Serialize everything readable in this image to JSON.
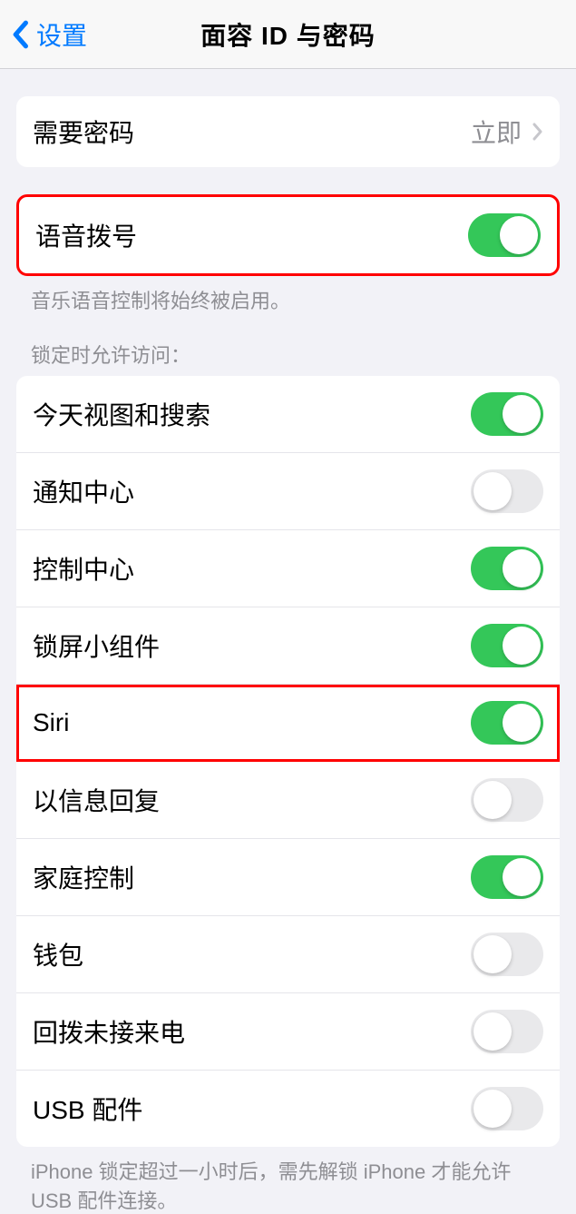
{
  "nav": {
    "back_label": "设置",
    "title": "面容 ID 与密码"
  },
  "passcode_section": {
    "require_label": "需要密码",
    "require_value": "立即"
  },
  "voice_dial": {
    "label": "语音拨号",
    "enabled": true,
    "footer": "音乐语音控制将始终被启用。"
  },
  "locked_access": {
    "header": "锁定时允许访问：",
    "items": [
      {
        "label": "今天视图和搜索",
        "enabled": true,
        "highlighted": false
      },
      {
        "label": "通知中心",
        "enabled": false,
        "highlighted": false
      },
      {
        "label": "控制中心",
        "enabled": true,
        "highlighted": false
      },
      {
        "label": "锁屏小组件",
        "enabled": true,
        "highlighted": false
      },
      {
        "label": "Siri",
        "enabled": true,
        "highlighted": true
      },
      {
        "label": "以信息回复",
        "enabled": false,
        "highlighted": false
      },
      {
        "label": "家庭控制",
        "enabled": true,
        "highlighted": false
      },
      {
        "label": "钱包",
        "enabled": false,
        "highlighted": false
      },
      {
        "label": "回拨未接来电",
        "enabled": false,
        "highlighted": false
      },
      {
        "label": "USB 配件",
        "enabled": false,
        "highlighted": false
      }
    ],
    "footer": "iPhone 锁定超过一小时后，需先解锁 iPhone 才能允许 USB 配件连接。"
  }
}
